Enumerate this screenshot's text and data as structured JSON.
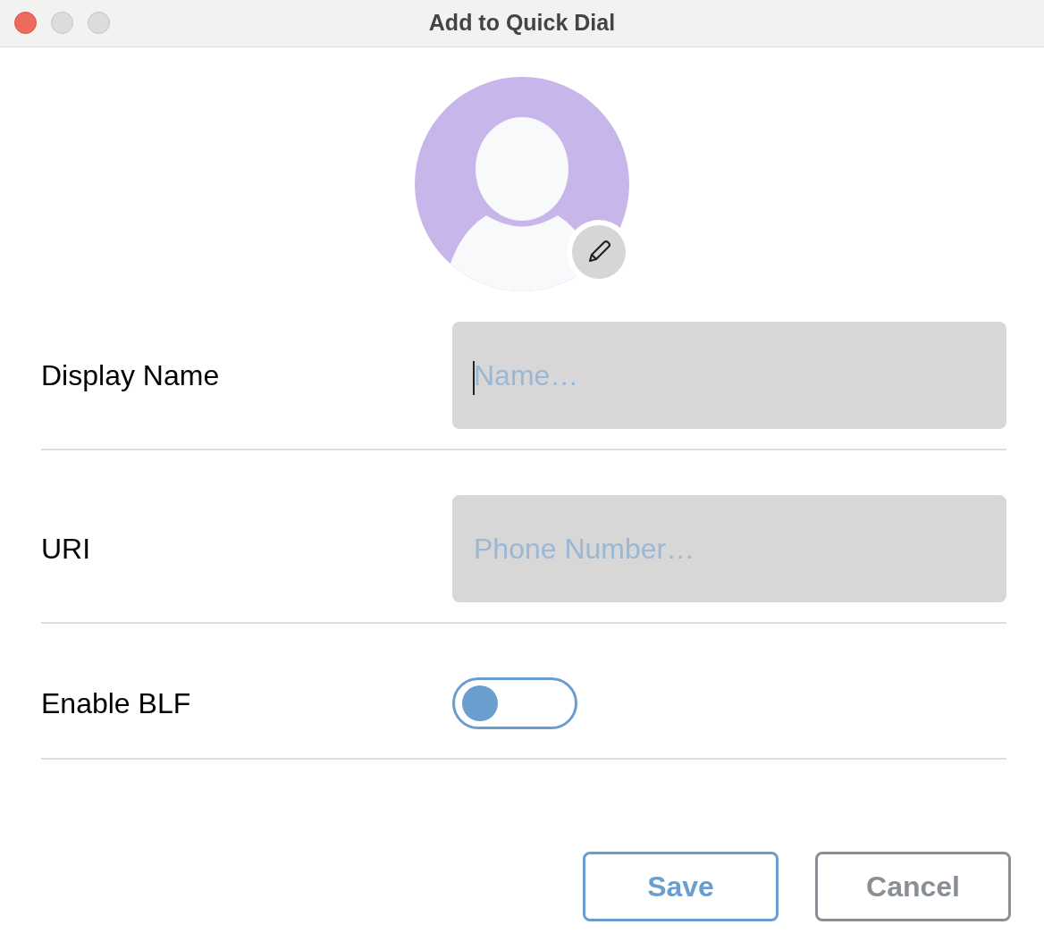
{
  "window": {
    "title": "Add to Quick Dial"
  },
  "fields": [
    {
      "label": "Display Name",
      "kind": "text",
      "placeholder": "Name…",
      "focused": true
    },
    {
      "label": "URI",
      "kind": "text",
      "placeholder": "Phone Number…",
      "focused": false
    },
    {
      "label": "Enable BLF",
      "kind": "toggle",
      "on": false
    }
  ],
  "buttons": [
    {
      "label": "Save",
      "kind": "primary"
    },
    {
      "label": "Cancel",
      "kind": "secondary"
    }
  ]
}
